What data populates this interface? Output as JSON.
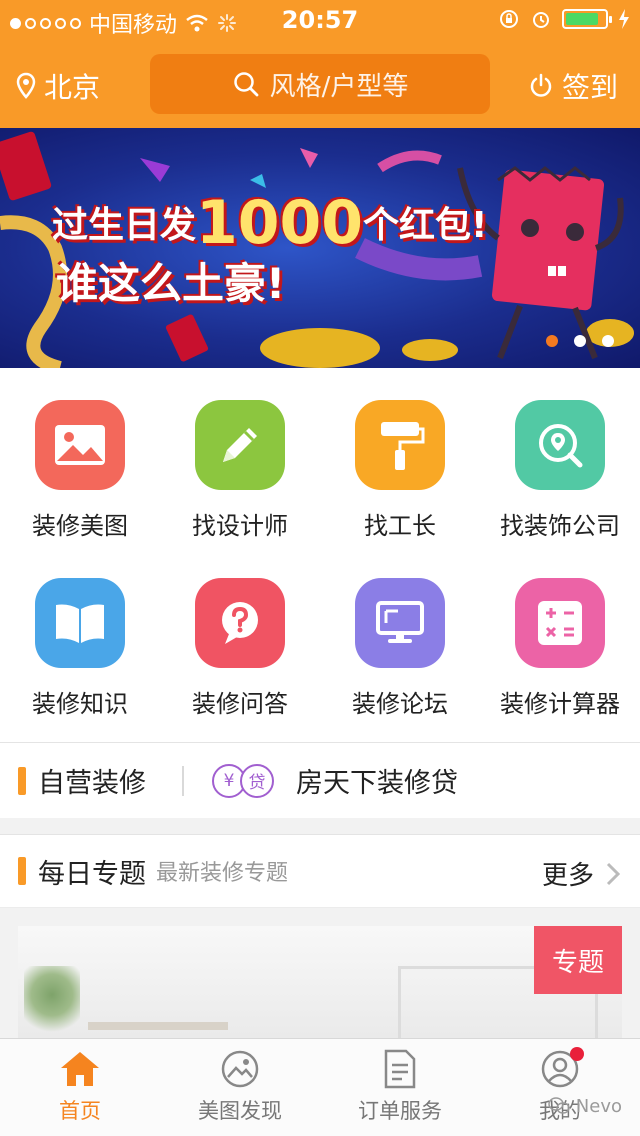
{
  "status": {
    "carrier": "中国移动",
    "time": "20:57",
    "battery_level": 0.85
  },
  "header": {
    "city": "北京",
    "search_placeholder": "风格/户型等",
    "signin_label": "签到"
  },
  "banner": {
    "line1_prefix": "过生日发",
    "line1_number": "1000",
    "line1_suffix": "个红包!",
    "line2": "谁这么土豪!",
    "slide_count": 3,
    "active_slide": 1
  },
  "grid": [
    {
      "label": "装修美图",
      "icon": "image-icon",
      "color": "#f3685b"
    },
    {
      "label": "找设计师",
      "icon": "pencil-icon",
      "color": "#8cc63f"
    },
    {
      "label": "找工长",
      "icon": "paint-roller-icon",
      "color": "#f9a825"
    },
    {
      "label": "找装饰公司",
      "icon": "location-search-icon",
      "color": "#52c9a4"
    },
    {
      "label": "装修知识",
      "icon": "book-icon",
      "color": "#4aa6e8"
    },
    {
      "label": "装修问答",
      "icon": "question-bubble-icon",
      "color": "#f05463"
    },
    {
      "label": "装修论坛",
      "icon": "monitor-icon",
      "color": "#8b7ee6"
    },
    {
      "label": "装修计算器",
      "icon": "calculator-icon",
      "color": "#ec63a6"
    }
  ],
  "promo": {
    "self_run": "自营装修",
    "loan_icon_chars": [
      "¥",
      "贷"
    ],
    "loan": "房天下装修贷"
  },
  "daily": {
    "title": "每日专题",
    "subtitle": "最新装修专题",
    "more": "更多",
    "badge": "专题"
  },
  "tabbar": [
    {
      "label": "首页",
      "icon": "home-icon",
      "active": true
    },
    {
      "label": "美图发现",
      "icon": "picture-discover-icon",
      "active": false
    },
    {
      "label": "订单服务",
      "icon": "order-document-icon",
      "active": false
    },
    {
      "label": "我的",
      "icon": "profile-icon",
      "active": false
    }
  ],
  "watermark": "Nevo",
  "colors": {
    "brand": "#f99a28",
    "active_tab": "#f5841f"
  }
}
